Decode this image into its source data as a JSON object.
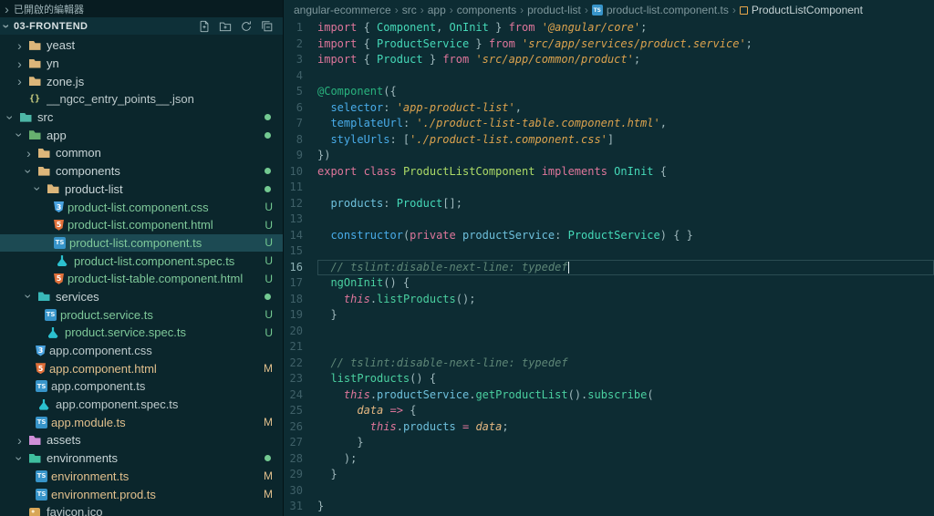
{
  "theme": {
    "sidebar_bg": "#0b262c",
    "editor_bg": "#0d2c33",
    "selected_row_bg": "#1c4a53",
    "git_untracked": "#73c991",
    "git_modified": "#e2c08d"
  },
  "sidebar": {
    "open_editors_label": "已開啟的編輯器",
    "section_title": "03-FRONTEND",
    "actions": [
      "new-file",
      "new-folder",
      "refresh-explorer",
      "collapse-folders"
    ],
    "tree": [
      {
        "label": "yeast",
        "level": 1,
        "type": "folder",
        "expanded": false,
        "color": "#dcb67a"
      },
      {
        "label": "yn",
        "level": 1,
        "type": "folder",
        "expanded": false,
        "color": "#dcb67a"
      },
      {
        "label": "zone.js",
        "level": 1,
        "type": "folder",
        "expanded": false,
        "color": "#dcb67a"
      },
      {
        "label": "__ngcc_entry_points__.json",
        "level": 1,
        "type": "file",
        "icon": "json"
      },
      {
        "label": "src",
        "level": 0,
        "type": "folder",
        "expanded": true,
        "color": "#4db6a6",
        "dot": true
      },
      {
        "label": "app",
        "level": 1,
        "type": "folder",
        "expanded": true,
        "color": "#67b06f",
        "dot": true
      },
      {
        "label": "common",
        "level": 2,
        "type": "folder",
        "expanded": false,
        "color": "#dcb67a"
      },
      {
        "label": "components",
        "level": 2,
        "type": "folder",
        "expanded": true,
        "color": "#dcb67a",
        "dot": true
      },
      {
        "label": "product-list",
        "level": 3,
        "type": "folder",
        "expanded": true,
        "color": "#dcb67a",
        "dot": true
      },
      {
        "label": "product-list.component.css",
        "level": 4,
        "type": "file",
        "icon": "css",
        "badge": "U"
      },
      {
        "label": "product-list.component.html",
        "level": 4,
        "type": "file",
        "icon": "html",
        "badge": "U"
      },
      {
        "label": "product-list.component.ts",
        "level": 4,
        "type": "file",
        "icon": "ts",
        "badge": "U",
        "selected": true
      },
      {
        "label": "product-list.component.spec.ts",
        "level": 4,
        "type": "file",
        "icon": "spec",
        "badge": "U"
      },
      {
        "label": "product-list-table.component.html",
        "level": 4,
        "type": "file",
        "icon": "html",
        "badge": "U"
      },
      {
        "label": "services",
        "level": 2,
        "type": "folder",
        "expanded": true,
        "color": "#39b8b8",
        "dot": true
      },
      {
        "label": "product.service.ts",
        "level": 3,
        "type": "file",
        "icon": "ts",
        "badge": "U"
      },
      {
        "label": "product.service.spec.ts",
        "level": 3,
        "type": "file",
        "icon": "spec",
        "badge": "U"
      },
      {
        "label": "app.component.css",
        "level": 2,
        "type": "file",
        "icon": "css"
      },
      {
        "label": "app.component.html",
        "level": 2,
        "type": "file",
        "icon": "html",
        "badge": "M"
      },
      {
        "label": "app.component.ts",
        "level": 2,
        "type": "file",
        "icon": "ts"
      },
      {
        "label": "app.component.spec.ts",
        "level": 2,
        "type": "file",
        "icon": "spec"
      },
      {
        "label": "app.module.ts",
        "level": 2,
        "type": "file",
        "icon": "ts",
        "badge": "M"
      },
      {
        "label": "assets",
        "level": 1,
        "type": "folder",
        "expanded": false,
        "color": "#cf8fd8"
      },
      {
        "label": "environments",
        "level": 1,
        "type": "folder",
        "expanded": true,
        "color": "#3fbf9f",
        "dot": true
      },
      {
        "label": "environment.ts",
        "level": 2,
        "type": "file",
        "icon": "ts",
        "badge": "M"
      },
      {
        "label": "environment.prod.ts",
        "level": 2,
        "type": "file",
        "icon": "ts",
        "badge": "M"
      },
      {
        "label": "favicon.ico",
        "level": 1,
        "type": "file",
        "icon": "image"
      }
    ]
  },
  "breadcrumb": {
    "items": [
      {
        "label": "angular-ecommerce"
      },
      {
        "label": "src"
      },
      {
        "label": "app"
      },
      {
        "label": "components"
      },
      {
        "label": "product-list"
      },
      {
        "label": "product-list.component.ts",
        "icon": "ts"
      },
      {
        "label": "ProductListComponent",
        "icon": "class"
      }
    ]
  },
  "editor": {
    "current_line": 16,
    "cursor_line": 16,
    "lines": [
      [
        [
          "kw",
          "import"
        ],
        [
          "pn",
          " { "
        ],
        [
          "ty",
          "Component"
        ],
        [
          "pn",
          ", "
        ],
        [
          "ty",
          "OnInit"
        ],
        [
          "pn",
          " } "
        ],
        [
          "kw",
          "from"
        ],
        [
          "tx",
          " "
        ],
        [
          "str",
          "'@angular/core'"
        ],
        [
          "pn",
          ";"
        ]
      ],
      [
        [
          "kw",
          "import"
        ],
        [
          "pn",
          " { "
        ],
        [
          "ty",
          "ProductService"
        ],
        [
          "pn",
          " } "
        ],
        [
          "kw",
          "from"
        ],
        [
          "tx",
          " "
        ],
        [
          "str",
          "'src/app/services/product.service'"
        ],
        [
          "pn",
          ";"
        ]
      ],
      [
        [
          "kw",
          "import"
        ],
        [
          "pn",
          " { "
        ],
        [
          "ty",
          "Product"
        ],
        [
          "pn",
          " } "
        ],
        [
          "kw",
          "from"
        ],
        [
          "tx",
          " "
        ],
        [
          "str",
          "'src/app/common/product'"
        ],
        [
          "pn",
          ";"
        ]
      ],
      [],
      [
        [
          "dec",
          "@Component"
        ],
        [
          "pn",
          "({"
        ]
      ],
      [
        [
          "tx",
          "  "
        ],
        [
          "pr",
          "selector"
        ],
        [
          "pn",
          ": "
        ],
        [
          "str",
          "'app-product-list'"
        ],
        [
          "pn",
          ","
        ]
      ],
      [
        [
          "tx",
          "  "
        ],
        [
          "pr",
          "templateUrl"
        ],
        [
          "pn",
          ": "
        ],
        [
          "str",
          "'./product-list-table.component.html'"
        ],
        [
          "pn",
          ","
        ]
      ],
      [
        [
          "tx",
          "  "
        ],
        [
          "pr",
          "styleUrls"
        ],
        [
          "pn",
          ": ["
        ],
        [
          "str",
          "'./product-list.component.css'"
        ],
        [
          "pn",
          "]"
        ]
      ],
      [
        [
          "pn",
          "})"
        ]
      ],
      [
        [
          "kw",
          "export"
        ],
        [
          "tx",
          " "
        ],
        [
          "kw",
          "class"
        ],
        [
          "tx",
          " "
        ],
        [
          "cls",
          "ProductListComponent"
        ],
        [
          "tx",
          " "
        ],
        [
          "kw",
          "implements"
        ],
        [
          "tx",
          " "
        ],
        [
          "ty",
          "OnInit"
        ],
        [
          "tx",
          " "
        ],
        [
          "pn",
          "{"
        ]
      ],
      [],
      [
        [
          "tx",
          "  "
        ],
        [
          "vr",
          "products"
        ],
        [
          "pn",
          ": "
        ],
        [
          "ty",
          "Product"
        ],
        [
          "pn",
          "[];"
        ]
      ],
      [],
      [
        [
          "tx",
          "  "
        ],
        [
          "pr",
          "constructor"
        ],
        [
          "pn",
          "("
        ],
        [
          "kw",
          "private"
        ],
        [
          "tx",
          " "
        ],
        [
          "vr",
          "productService"
        ],
        [
          "pn",
          ": "
        ],
        [
          "ty",
          "ProductService"
        ],
        [
          "pn",
          ") { }"
        ]
      ],
      [],
      [
        [
          "tx",
          "  "
        ],
        [
          "cm",
          "// tslint:disable-next-line: typedef"
        ]
      ],
      [
        [
          "tx",
          "  "
        ],
        [
          "fn",
          "ngOnInit"
        ],
        [
          "pn",
          "() {"
        ]
      ],
      [
        [
          "tx",
          "    "
        ],
        [
          "th",
          "this"
        ],
        [
          "pn",
          "."
        ],
        [
          "fn",
          "listProducts"
        ],
        [
          "pn",
          "();"
        ]
      ],
      [
        [
          "tx",
          "  "
        ],
        [
          "pn",
          "}"
        ]
      ],
      [],
      [],
      [
        [
          "tx",
          "  "
        ],
        [
          "cm",
          "// tslint:disable-next-line: typedef"
        ]
      ],
      [
        [
          "tx",
          "  "
        ],
        [
          "fn",
          "listProducts"
        ],
        [
          "pn",
          "() {"
        ]
      ],
      [
        [
          "tx",
          "    "
        ],
        [
          "th",
          "this"
        ],
        [
          "pn",
          "."
        ],
        [
          "vr",
          "productService"
        ],
        [
          "pn",
          "."
        ],
        [
          "fn",
          "getProductList"
        ],
        [
          "pn",
          "()."
        ],
        [
          "fn",
          "subscribe"
        ],
        [
          "pn",
          "("
        ]
      ],
      [
        [
          "tx",
          "      "
        ],
        [
          "pm",
          "data"
        ],
        [
          "tx",
          " "
        ],
        [
          "kw",
          "=>"
        ],
        [
          "tx",
          " "
        ],
        [
          "pn",
          "{"
        ]
      ],
      [
        [
          "tx",
          "        "
        ],
        [
          "th",
          "this"
        ],
        [
          "pn",
          "."
        ],
        [
          "vr",
          "products"
        ],
        [
          "tx",
          " "
        ],
        [
          "kw",
          "="
        ],
        [
          "tx",
          " "
        ],
        [
          "pm",
          "data"
        ],
        [
          "pn",
          ";"
        ]
      ],
      [
        [
          "tx",
          "      "
        ],
        [
          "pn",
          "}"
        ]
      ],
      [
        [
          "tx",
          "    "
        ],
        [
          "pn",
          ");"
        ]
      ],
      [
        [
          "tx",
          "  "
        ],
        [
          "pn",
          "}"
        ]
      ],
      [],
      [
        [
          "pn",
          "}"
        ]
      ]
    ]
  }
}
